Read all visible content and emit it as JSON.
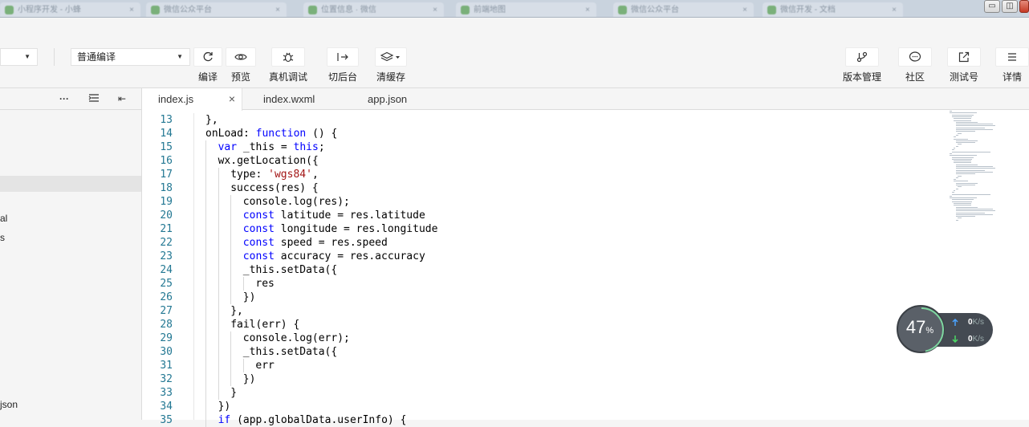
{
  "browser_tabs": [
    {
      "label": "小程序开发 - 小蜂"
    },
    {
      "label": "微信公众平台"
    },
    {
      "label": "位置信息 · 微信"
    },
    {
      "label": "前端地图"
    },
    {
      "label": "微信公众平台"
    },
    {
      "label": "微信开发 - 文档"
    }
  ],
  "window_controls": {
    "minimize": "▭",
    "maximize": "◫",
    "close": ""
  },
  "toolbar": {
    "mode_select": "",
    "compile_select": "普通编译",
    "tools": [
      {
        "icon": "refresh-icon",
        "label": "编译"
      },
      {
        "icon": "eye-icon",
        "label": "预览"
      },
      {
        "icon": "bug-icon",
        "label": "真机调试"
      },
      {
        "icon": "switch-icon",
        "label": "切后台"
      },
      {
        "icon": "layers-icon",
        "label": "清缓存"
      },
      {
        "icon": "branch-icon",
        "label": "版本管理"
      },
      {
        "icon": "chat-icon",
        "label": "社区"
      },
      {
        "icon": "external-link-icon",
        "label": "测试号"
      },
      {
        "icon": "menu-icon",
        "label": "详情"
      }
    ]
  },
  "sidebar": {
    "icons": {
      "more": "···",
      "collapse": "⇤"
    },
    "items": [
      {
        "label": "al"
      },
      {
        "label": "s"
      },
      {
        "label": "json"
      }
    ]
  },
  "editor": {
    "tabs": [
      {
        "label": "index.js",
        "active": true
      },
      {
        "label": "index.wxml",
        "active": false
      },
      {
        "label": "app.json",
        "active": false
      }
    ],
    "lines": [
      {
        "n": "13",
        "indent": 0,
        "tokens": [
          [
            "",
            "},"
          ]
        ]
      },
      {
        "n": "14",
        "indent": 0,
        "tokens": [
          [
            "",
            "onLoad: "
          ],
          [
            "kw",
            "function"
          ],
          [
            "",
            " () {"
          ]
        ]
      },
      {
        "n": "15",
        "indent": 1,
        "tokens": [
          [
            "kw",
            "var"
          ],
          [
            "",
            " _this = "
          ],
          [
            "kw",
            "this"
          ],
          [
            "",
            ";"
          ]
        ]
      },
      {
        "n": "16",
        "indent": 1,
        "tokens": [
          [
            "",
            "wx.getLocation({"
          ]
        ]
      },
      {
        "n": "17",
        "indent": 2,
        "tokens": [
          [
            "",
            "type: "
          ],
          [
            "str",
            "'wgs84'"
          ],
          [
            "",
            ","
          ]
        ]
      },
      {
        "n": "18",
        "indent": 2,
        "tokens": [
          [
            "",
            "success(res) {"
          ]
        ]
      },
      {
        "n": "19",
        "indent": 3,
        "tokens": [
          [
            "",
            "console.log(res);"
          ]
        ]
      },
      {
        "n": "20",
        "indent": 3,
        "tokens": [
          [
            "kw",
            "const"
          ],
          [
            "",
            " latitude = res.latitude"
          ]
        ]
      },
      {
        "n": "21",
        "indent": 3,
        "tokens": [
          [
            "kw",
            "const"
          ],
          [
            "",
            " longitude = res.longitude"
          ]
        ]
      },
      {
        "n": "22",
        "indent": 3,
        "tokens": [
          [
            "kw",
            "const"
          ],
          [
            "",
            " speed = res.speed"
          ]
        ]
      },
      {
        "n": "23",
        "indent": 3,
        "tokens": [
          [
            "kw",
            "const"
          ],
          [
            "",
            " accuracy = res.accuracy"
          ]
        ]
      },
      {
        "n": "24",
        "indent": 3,
        "tokens": [
          [
            "",
            "_this.setData({"
          ]
        ]
      },
      {
        "n": "25",
        "indent": 4,
        "tokens": [
          [
            "",
            "res"
          ]
        ]
      },
      {
        "n": "26",
        "indent": 3,
        "tokens": [
          [
            "",
            "})"
          ]
        ]
      },
      {
        "n": "27",
        "indent": 2,
        "tokens": [
          [
            "",
            "},"
          ]
        ]
      },
      {
        "n": "28",
        "indent": 2,
        "tokens": [
          [
            "",
            "fail(err) {"
          ]
        ]
      },
      {
        "n": "29",
        "indent": 3,
        "tokens": [
          [
            "",
            "console.log(err);"
          ]
        ]
      },
      {
        "n": "30",
        "indent": 3,
        "tokens": [
          [
            "",
            "_this.setData({"
          ]
        ]
      },
      {
        "n": "31",
        "indent": 4,
        "tokens": [
          [
            "",
            "err"
          ]
        ]
      },
      {
        "n": "32",
        "indent": 3,
        "tokens": [
          [
            "",
            "})"
          ]
        ]
      },
      {
        "n": "33",
        "indent": 2,
        "tokens": [
          [
            "",
            "}"
          ]
        ]
      },
      {
        "n": "34",
        "indent": 1,
        "tokens": [
          [
            "",
            "})"
          ]
        ]
      },
      {
        "n": "35",
        "indent": 1,
        "tokens": [
          [
            "kw",
            "if"
          ],
          [
            "",
            " (app.globalData.userInfo) {"
          ]
        ]
      }
    ]
  },
  "speed_widget": {
    "percent": "47",
    "percent_unit": "%",
    "up": "0",
    "down": "0",
    "unit": "K/s",
    "up_color": "#4aa3ff",
    "down_color": "#4cd964"
  }
}
